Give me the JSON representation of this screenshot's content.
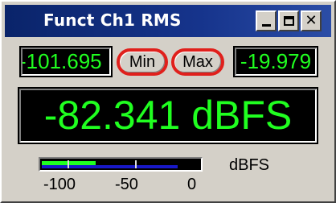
{
  "window": {
    "title": "Funct Ch1 RMS",
    "controls": {
      "minimize": "minimize-icon",
      "maximize": "maximize-icon",
      "close": "close-icon",
      "close_glyph": "✕"
    }
  },
  "readouts": {
    "min_value": "-101.695",
    "max_value": "-19.979",
    "main_value": "-82.341 dBFS"
  },
  "buttons": {
    "min_label": "Min",
    "max_label": "Max"
  },
  "bargraph": {
    "unit": "dBFS",
    "scale": [
      "-100",
      "-50",
      "0"
    ],
    "green_level": 0.34,
    "blue_level": 0.86,
    "colors": {
      "green": "#20ff20",
      "blue": "#1818c8",
      "highlight": "#e0201c"
    }
  }
}
